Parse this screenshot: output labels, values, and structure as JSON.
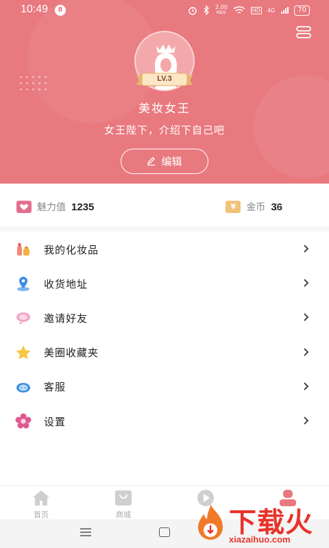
{
  "status_bar": {
    "time": "10:49",
    "notification_count": "8",
    "network_speed_value": "2.00",
    "network_speed_unit": "KB/S",
    "hd_label": "HD",
    "signal_label": "4G",
    "battery": "70"
  },
  "profile": {
    "level": "LV.3",
    "username": "美妆女王",
    "bio": "女王陛下，介绍下自己吧",
    "edit_label": "编辑"
  },
  "stats": {
    "charm_label": "魅力值",
    "charm_value": "1235",
    "coins_icon_text": "¥",
    "coins_label": "金币",
    "coins_value": "36"
  },
  "menu": {
    "items": [
      {
        "label": "我的化妆品",
        "icon": "cosmetics-icon"
      },
      {
        "label": "收货地址",
        "icon": "location-icon"
      },
      {
        "label": "邀请好友",
        "icon": "invite-icon"
      },
      {
        "label": "美圈收藏夹",
        "icon": "star-icon"
      },
      {
        "label": "客服",
        "icon": "headset-icon"
      },
      {
        "label": "设置",
        "icon": "settings-flower-icon"
      }
    ]
  },
  "tabbar": {
    "tabs": [
      {
        "label": "首页",
        "icon": "home-icon"
      },
      {
        "label": "商城",
        "icon": "shop-bag-icon"
      },
      {
        "label": "",
        "icon": "video-play-icon"
      },
      {
        "label": "",
        "icon": "profile-icon"
      }
    ]
  },
  "watermark": {
    "text": "下载火",
    "url": "xiazaihuo.com"
  },
  "colors": {
    "header_bg": "#e8797f",
    "accent_pink": "#e8797f",
    "watermark_red": "#e8322b"
  }
}
